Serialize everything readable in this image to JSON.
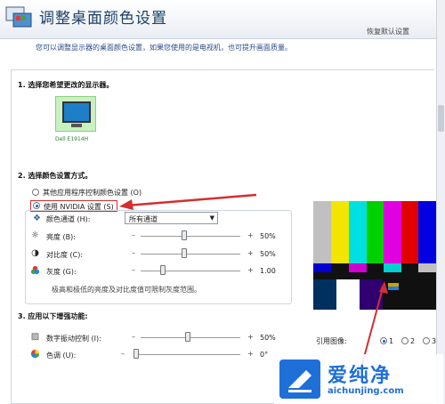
{
  "header": {
    "title": "调整桌面颜色设置",
    "restore_link": "恢复默认设置",
    "description": "您可以调整显示器的桌面颜色设置，如果您使用的是电视机，也可提升画面质量。"
  },
  "section1": {
    "heading": "1.  选择您希望更改的显示器。",
    "monitor_label": "Dell E1914H"
  },
  "section2": {
    "heading": "2.  选择颜色设置方式。",
    "option_other": "其他应用程序控制颜色设置 (O)",
    "option_nvidia": "使用 NVIDIA 设置 (S)",
    "option_nvidia_selected": true,
    "channel_label": "颜色通道 (H):",
    "channel_value": "所有通道",
    "sliders": [
      {
        "label": "亮度 (B):",
        "value": "50%",
        "level": 0.5
      },
      {
        "label": "对比度 (C):",
        "value": "50%",
        "level": 0.5
      },
      {
        "label": "灰度 (G):",
        "value": "1.00",
        "level": 0.3
      }
    ],
    "note": "极高和极低的亮度及对比度值可限制灰度范围。"
  },
  "section3": {
    "heading": "3.  应用以下增强功能:",
    "sliders": [
      {
        "label": "数字振动控制 (I):",
        "value": "50%",
        "level": 0.5
      },
      {
        "label": "色调 (U):",
        "value": "0°",
        "level": 0.0
      }
    ]
  },
  "reference": {
    "label": "引用图像:",
    "options": [
      "1",
      "2",
      "3"
    ],
    "selected": "1"
  },
  "watermark": {
    "brand": "爱纯净",
    "url": "aichunjing.com"
  },
  "colors": {
    "title": "#1c3f66",
    "accent_red": "#d32f2f",
    "selection": "#1a5fb4",
    "watermark_blue": "#1e6fd8"
  }
}
